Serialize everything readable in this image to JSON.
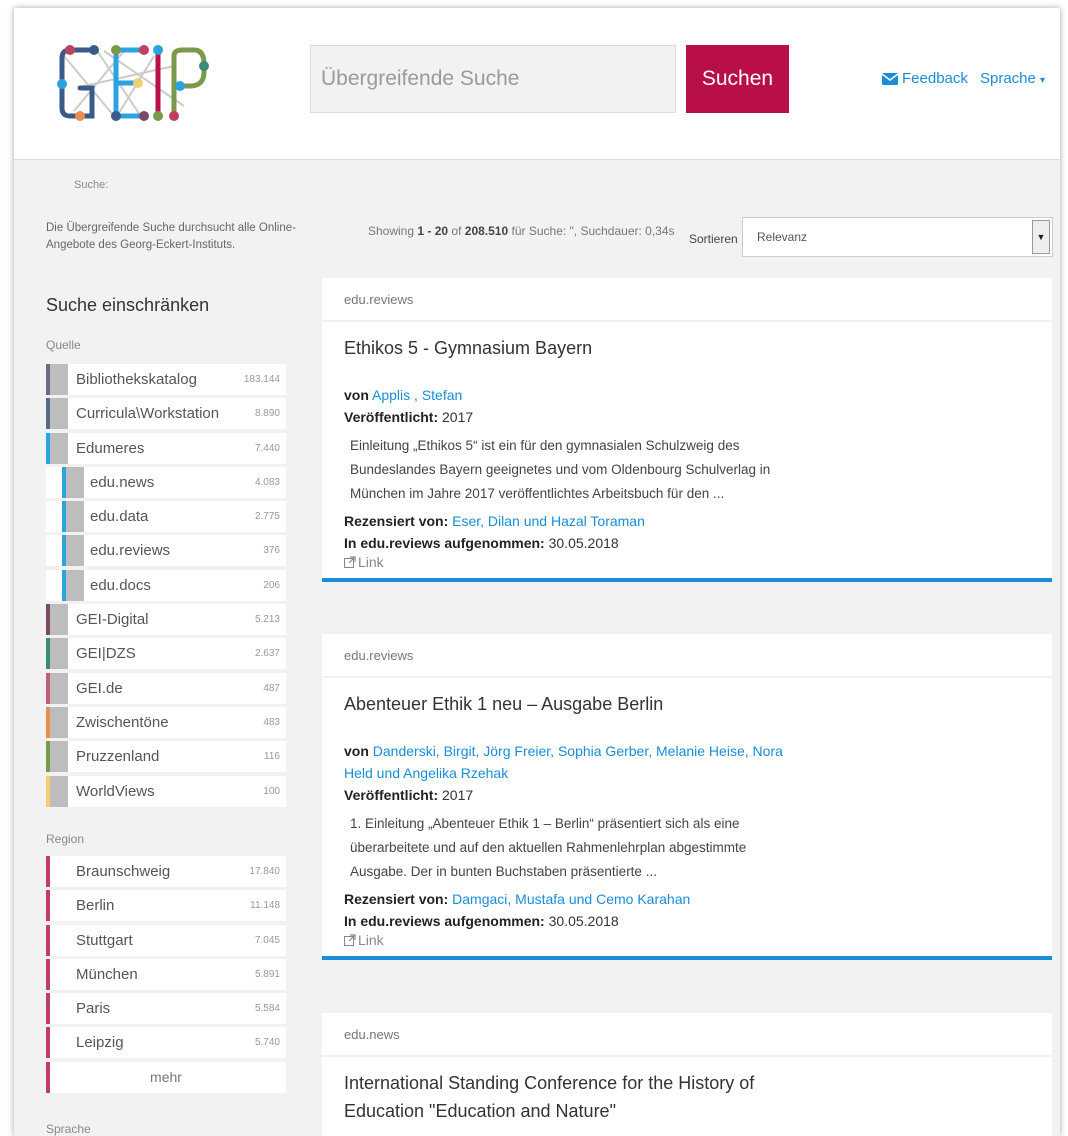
{
  "header": {
    "search_placeholder": "Übergreifende Suche",
    "search_button": "Suchen",
    "feedback": "Feedback",
    "language": "Sprache",
    "caret": "▾"
  },
  "breadcrumb": "Suche:",
  "intro": "Die Übergreifende Suche durchsucht alle Online-Angebote des Georg-Eckert-Instituts.",
  "results_bar": {
    "showing": "Showing",
    "range": "1 - 20",
    "of": "of",
    "total": "208.510",
    "suffix": "für Suche: \", Suchdauer: 0,34s",
    "sort_label": "Sortieren",
    "sort_value": "Relevanz"
  },
  "facets": {
    "title": "Suche einschränken",
    "quelle_label": "Quelle",
    "quelle": [
      {
        "label": "Bibliothekskatalog",
        "count": "183.144",
        "color": "#6a6a8a",
        "sub": false
      },
      {
        "label": "Curricula\\Workstation",
        "count": "8.890",
        "color": "#5a6a8a",
        "sub": false
      },
      {
        "label": "Edumeres",
        "count": "7.440",
        "color": "#2aa3e0",
        "sub": false
      },
      {
        "label": "edu.news",
        "count": "4.083",
        "color": "#2aa3e0",
        "sub": true
      },
      {
        "label": "edu.data",
        "count": "2.775",
        "color": "#2aa3e0",
        "sub": true
      },
      {
        "label": "edu.reviews",
        "count": "376",
        "color": "#2aa3e0",
        "sub": true
      },
      {
        "label": "edu.docs",
        "count": "206",
        "color": "#2aa3e0",
        "sub": true
      },
      {
        "label": "GEI-Digital",
        "count": "5.213",
        "color": "#7a4a6a",
        "sub": false
      },
      {
        "label": "GEI|DZS",
        "count": "2.637",
        "color": "#3a8a7a",
        "sub": false
      },
      {
        "label": "GEI.de",
        "count": "487",
        "color": "#c06070",
        "sub": false
      },
      {
        "label": "Zwischentöne",
        "count": "483",
        "color": "#e89050",
        "sub": false
      },
      {
        "label": "Pruzzenland",
        "count": "116",
        "color": "#7a9a4a",
        "sub": false
      },
      {
        "label": "WorldViews",
        "count": "100",
        "color": "#f0d070",
        "sub": false
      }
    ],
    "region_label": "Region",
    "region": [
      {
        "label": "Braunschweig",
        "count": "17.840",
        "color": "#c04060"
      },
      {
        "label": "Berlin",
        "count": "11.148",
        "color": "#c04060"
      },
      {
        "label": "Stuttgart",
        "count": "7.045",
        "color": "#c04060"
      },
      {
        "label": "München",
        "count": "5.891",
        "color": "#c04060"
      },
      {
        "label": "Paris",
        "count": "5.584",
        "color": "#c04060"
      },
      {
        "label": "Leipzig",
        "count": "5.740",
        "color": "#c04060"
      }
    ],
    "more": "mehr",
    "sprache_label": "Sprache"
  },
  "results": [
    {
      "source": "edu.reviews",
      "title": "Ethikos 5 - Gymnasium Bayern",
      "by_label": "von",
      "authors": "Applis , Stefan",
      "published_label": "Veröffentlicht:",
      "published": "2017",
      "abstract": "Einleitung „Ethikos 5“ ist ein für den gymnasialen Schulzweig des Bundeslandes Bayern geeignetes und vom Oldenbourg Schulverlag in München im Jahre 2017 veröffentlichtes Arbeitsbuch für den ...",
      "reviewed_label": "Rezensiert von:",
      "reviewers": "Eser, Dilan und Hazal Toraman",
      "added_label": "In edu.reviews aufgenommen:",
      "added": "30.05.2018",
      "link": "Link"
    },
    {
      "source": "edu.reviews",
      "title": "Abenteuer Ethik 1 neu – Ausgabe Berlin",
      "by_label": "von",
      "authors": "Danderski, Birgit, Jörg Freier, Sophia Gerber, Melanie Heise, Nora Held und Angelika Rzehak",
      "published_label": "Veröffentlicht:",
      "published": "2017",
      "abstract": "1. Einleitung „Abenteuer Ethik 1 – Berlin“ präsentiert sich als eine überarbeitete und auf den aktuellen Rahmenlehrplan abgestimmte Ausgabe. Der in bunten Buchstaben präsentierte ...",
      "reviewed_label": "Rezensiert von:",
      "reviewers": "Damgaci, Mustafa und Cemo Karahan",
      "added_label": "In edu.reviews aufgenommen:",
      "added": "30.05.2018",
      "link": "Link"
    },
    {
      "source": "edu.news",
      "title": "International Standing Conference for the History of Education \"Education and Nature\""
    }
  ]
}
